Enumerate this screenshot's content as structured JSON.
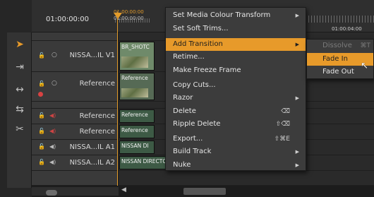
{
  "timeline": {
    "timecode_start": "01:00:00:00",
    "timecode_playhead_a": "01:00:00:00",
    "timecode_playhead_b": "01:00:00:00",
    "timecode_end": "01:00:04:00"
  },
  "tools": [
    "select-icon",
    "track-forward-icon",
    "slip-icon",
    "slide-icon",
    "razor-icon"
  ],
  "tracks": [
    {
      "name": "NISSA...IL V1",
      "clip_label": "BR_SHOTC"
    },
    {
      "name": "Reference",
      "clip_label": "Reference"
    },
    {
      "name": "Reference",
      "clip_label": "Reference"
    },
    {
      "name": "Reference",
      "clip_label": "Reference"
    },
    {
      "name": "NISSA...IL A1",
      "clip_label": "NISSAN DI"
    },
    {
      "name": "NISSA...IL A2",
      "clip_label": "NISSAN DIRECTORS CUT MUSIC"
    }
  ],
  "context_menu": {
    "items": [
      {
        "label": "Set Media Colour Transform",
        "submenu": true,
        "shortcut": ""
      },
      {
        "label": "Set Soft Trims...",
        "submenu": false,
        "shortcut": ""
      },
      {
        "label": "Add Transition",
        "submenu": true,
        "shortcut": ""
      },
      {
        "label": "Retime...",
        "submenu": false,
        "shortcut": ""
      },
      {
        "label": "Make Freeze Frame",
        "submenu": false,
        "shortcut": ""
      },
      {
        "label": "Copy Cuts...",
        "submenu": false,
        "shortcut": ""
      },
      {
        "label": "Razor",
        "submenu": true,
        "shortcut": ""
      },
      {
        "label": "Delete",
        "submenu": false,
        "shortcut": "⌫"
      },
      {
        "label": "Ripple Delete",
        "submenu": false,
        "shortcut": "⇧⌫"
      },
      {
        "label": "Export...",
        "submenu": false,
        "shortcut": "⇧⌘E"
      },
      {
        "label": "Build Track",
        "submenu": true,
        "shortcut": ""
      },
      {
        "label": "Nuke",
        "submenu": true,
        "shortcut": ""
      }
    ],
    "active_index": 2
  },
  "transition_submenu": {
    "items": [
      {
        "label": "Dissolve",
        "shortcut": "⌘T",
        "disabled": true
      },
      {
        "label": "Fade In",
        "shortcut": "",
        "disabled": false
      },
      {
        "label": "Fade Out",
        "shortcut": "",
        "disabled": false
      }
    ],
    "active_index": 1
  },
  "colors": {
    "accent": "#e79a2a",
    "menu_bg": "#3c3c3c",
    "clip_video": "#6f8a6a",
    "clip_audio": "#3d5a45"
  }
}
